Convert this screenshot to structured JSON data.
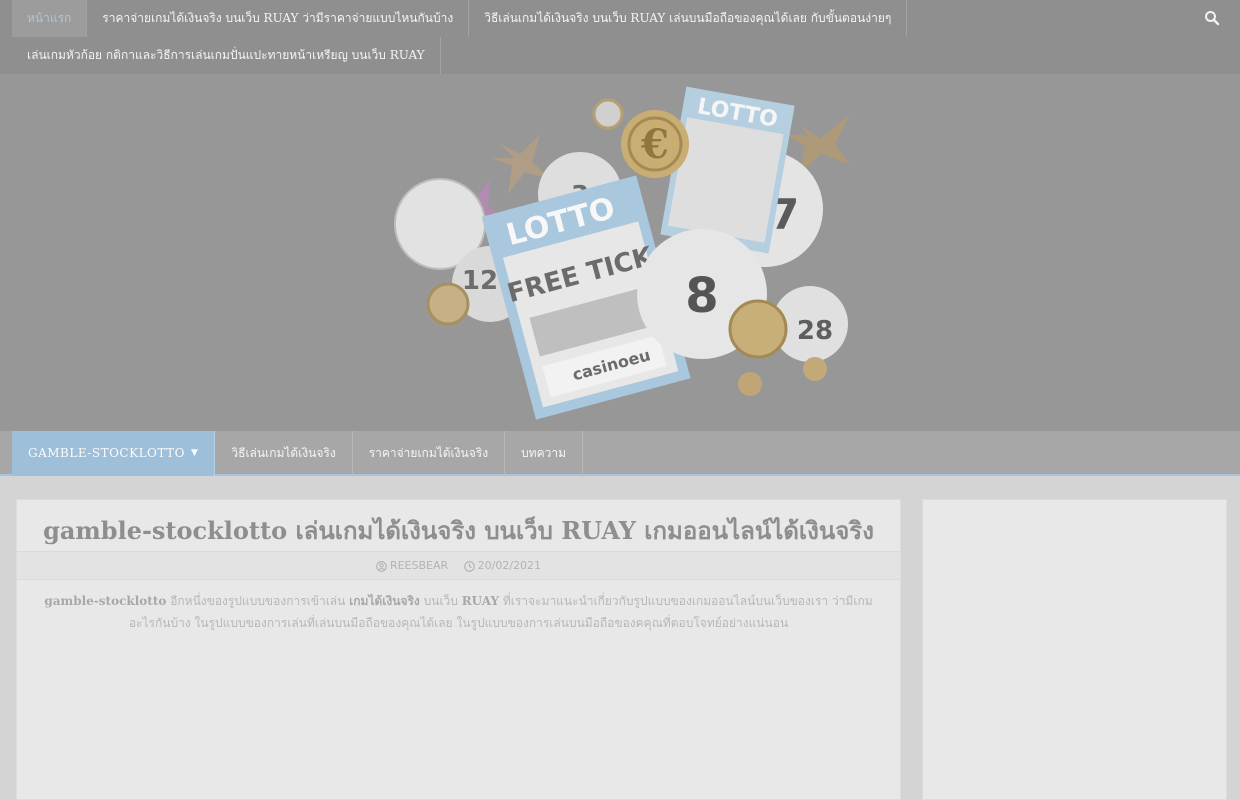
{
  "top_nav": {
    "items": [
      {
        "label": "หน้าแรก"
      },
      {
        "label": "ราคาจ่ายเกมได้เงินจริง บนเว็บ RUAY ว่ามีราคาจ่ายแบบไหนกันบ้าง"
      },
      {
        "label": "วิธีเล่นเกมได้เงินจริง บนเว็บ RUAY เล่นบนมือถือของคุณได้เลย กับขั้นตอนง่ายๆ"
      },
      {
        "label": "เล่นเกมหัวก้อย กติกาและวิธีการเล่นเกมปั่นแปะทายหน้าเหรียญ บนเว็บ RUAY"
      }
    ],
    "search_icon": "search-icon"
  },
  "banner": {
    "lotto_text": "LOTTO",
    "ticket_text": "FREE TICK",
    "brand_text": "casinoeu",
    "balls": [
      "8",
      "17",
      "28",
      "12",
      "3"
    ],
    "currency": "€"
  },
  "main_nav": {
    "items": [
      {
        "label": "GAMBLE-STOCKLOTTO"
      },
      {
        "label": "วิธีเล่นเกมได้เงินจริง"
      },
      {
        "label": "ราคาจ่ายเกมได้เงินจริง"
      },
      {
        "label": "บทความ"
      }
    ]
  },
  "post": {
    "title": "gamble-stocklotto เล่นเกมได้เงินจริง บนเว็บ RUAY เกมออนไลน์ได้เงินจริง",
    "author": "REESBEAR",
    "date": "20/02/2021",
    "body_bold_1": "gamble-stocklotto",
    "body_text_1": " อีกหนึ่งของรูปแบบของการเข้าเล่น ",
    "body_bold_2": "เกมได้เงินจริง",
    "body_text_2": " บนเว็บ ",
    "body_bold_3": "RUAY",
    "body_text_3": " ที่เราจะมาแนะนำเกี่ยวกับรูปแบบของเกมออนไลน์บนเว็บของเรา ว่ามีเกมอะไรกันบ้าง ในรูปแบบของการเล่นที่เล่นบนมือถือของคุณได้เลย ในรูปแบบของการเล่นบนมือถือของคคุณที่ตอบโจทย์อย่างแน่นอน"
  },
  "colors": {
    "accent": "#9ebfd9",
    "top_bar": "#8f8f8f",
    "header_bg": "#979797"
  }
}
